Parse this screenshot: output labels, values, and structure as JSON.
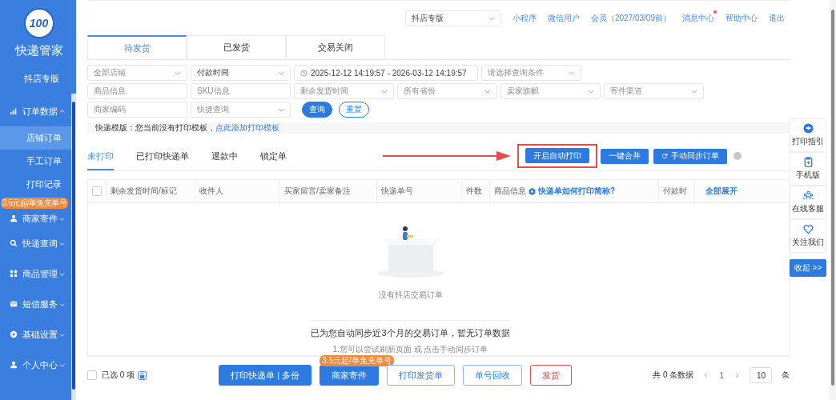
{
  "sidebar": {
    "logo_text": "100",
    "title": "快递管家",
    "edition": "抖店专版",
    "items": [
      {
        "label": "订单数据",
        "expanded": true,
        "selected": false,
        "children": [
          {
            "label": "店铺订单",
            "selected": true
          },
          {
            "label": "手工订单",
            "selected": false
          },
          {
            "label": "打印记录",
            "selected": false
          }
        ]
      },
      {
        "label": "商家寄件",
        "badge": "3.5元起/单免充单号",
        "expanded": false,
        "selected": false
      },
      {
        "label": "快递查询",
        "expanded": false,
        "selected": false
      },
      {
        "label": "商品管理",
        "expanded": false,
        "selected": false
      },
      {
        "label": "短信服务",
        "expanded": false,
        "selected": false
      },
      {
        "label": "基础设置",
        "expanded": false,
        "selected": false
      },
      {
        "label": "个人中心",
        "expanded": false,
        "selected": false
      }
    ]
  },
  "top_bar": {
    "edition_select": "抖店专版",
    "links": [
      {
        "label": "小程序",
        "dot": false
      },
      {
        "label": "微信用户",
        "dot": false
      },
      {
        "label": "会员（2027/03/09前）",
        "dot": false
      },
      {
        "label": "消息中心",
        "dot": true
      },
      {
        "label": "帮助中心",
        "dot": false
      },
      {
        "label": "退出",
        "dot": false
      }
    ]
  },
  "tabs": [
    {
      "label": "待发货",
      "selected": true
    },
    {
      "label": "已发货",
      "selected": false
    },
    {
      "label": "交易关闭",
      "selected": false
    }
  ],
  "filters": [
    [
      {
        "kind": "select",
        "placeholder": "全部店铺"
      },
      {
        "kind": "select",
        "value": "付款时间"
      },
      {
        "kind": "daterange",
        "value": "2025-12-12 14:19:57 - 2026-03-12 14:19:57"
      },
      {
        "kind": "select",
        "placeholder": "请选择查询条件"
      }
    ],
    [
      {
        "kind": "input",
        "placeholder": "商品信息"
      },
      {
        "kind": "input",
        "placeholder": "SKU信息"
      },
      {
        "kind": "select",
        "placeholder": "剩余发货时间"
      },
      {
        "kind": "select",
        "placeholder": "所有省份"
      },
      {
        "kind": "select",
        "placeholder": "卖家旗帜"
      },
      {
        "kind": "select",
        "placeholder": "寄件渠道"
      }
    ],
    [
      {
        "kind": "input",
        "placeholder": "商家编码"
      },
      {
        "kind": "select",
        "placeholder": "快捷查询"
      },
      {
        "kind": "primary",
        "label": "查询"
      },
      {
        "kind": "outline",
        "label": "重置"
      }
    ]
  ],
  "notice": {
    "text": "快递模版：您当前没有打印模板，",
    "link": "点此添加打印模板"
  },
  "sub_tabs": [
    {
      "label": "未打印",
      "selected": true
    },
    {
      "label": "已打印快递单",
      "selected": false
    },
    {
      "label": "退款中",
      "selected": false
    },
    {
      "label": "锁定单",
      "selected": false
    }
  ],
  "actions": [
    {
      "label": "开启自动打印",
      "highlighted": true
    },
    {
      "label": "一键合并",
      "highlighted": false
    },
    {
      "label": "手动同步订单",
      "highlighted": false
    }
  ],
  "table": {
    "select_all": false,
    "columns": [
      "剩余发货时间/标记",
      "收件人",
      "买家留言/卖家备注",
      "快递单号",
      "件数",
      "商品信息",
      "付款时"
    ],
    "help_link": "快递单如何打印简称?",
    "expand_all": "全部展开"
  },
  "empty": {
    "caption": "没有抖店交易订单",
    "message": "已为您自动同步近3个月的交易订单，暂无订单数据",
    "hint": "1.您可以尝试刷新页面 或 点击手动同步订单"
  },
  "side_panel": [
    {
      "label": "打印指引"
    },
    {
      "label": "手机版"
    },
    {
      "label": "在线客服"
    },
    {
      "label": "关注我们"
    }
  ],
  "collapse_button": "收起 >>",
  "footer": {
    "select_all": false,
    "selected_count": "已选 0 项",
    "buttons": [
      {
        "label": "打印快递单 | 多份",
        "kind": "primary"
      },
      {
        "label": "商家寄件",
        "kind": "primary",
        "badge": "3.5元起/单免充单号"
      },
      {
        "label": "打印发货单",
        "kind": "outline"
      },
      {
        "label": "单号回收",
        "kind": "outline"
      },
      {
        "label": "发货",
        "kind": "danger"
      }
    ],
    "total": "共 0 条数据",
    "page": "1",
    "page_size": "10",
    "unit": "条"
  }
}
